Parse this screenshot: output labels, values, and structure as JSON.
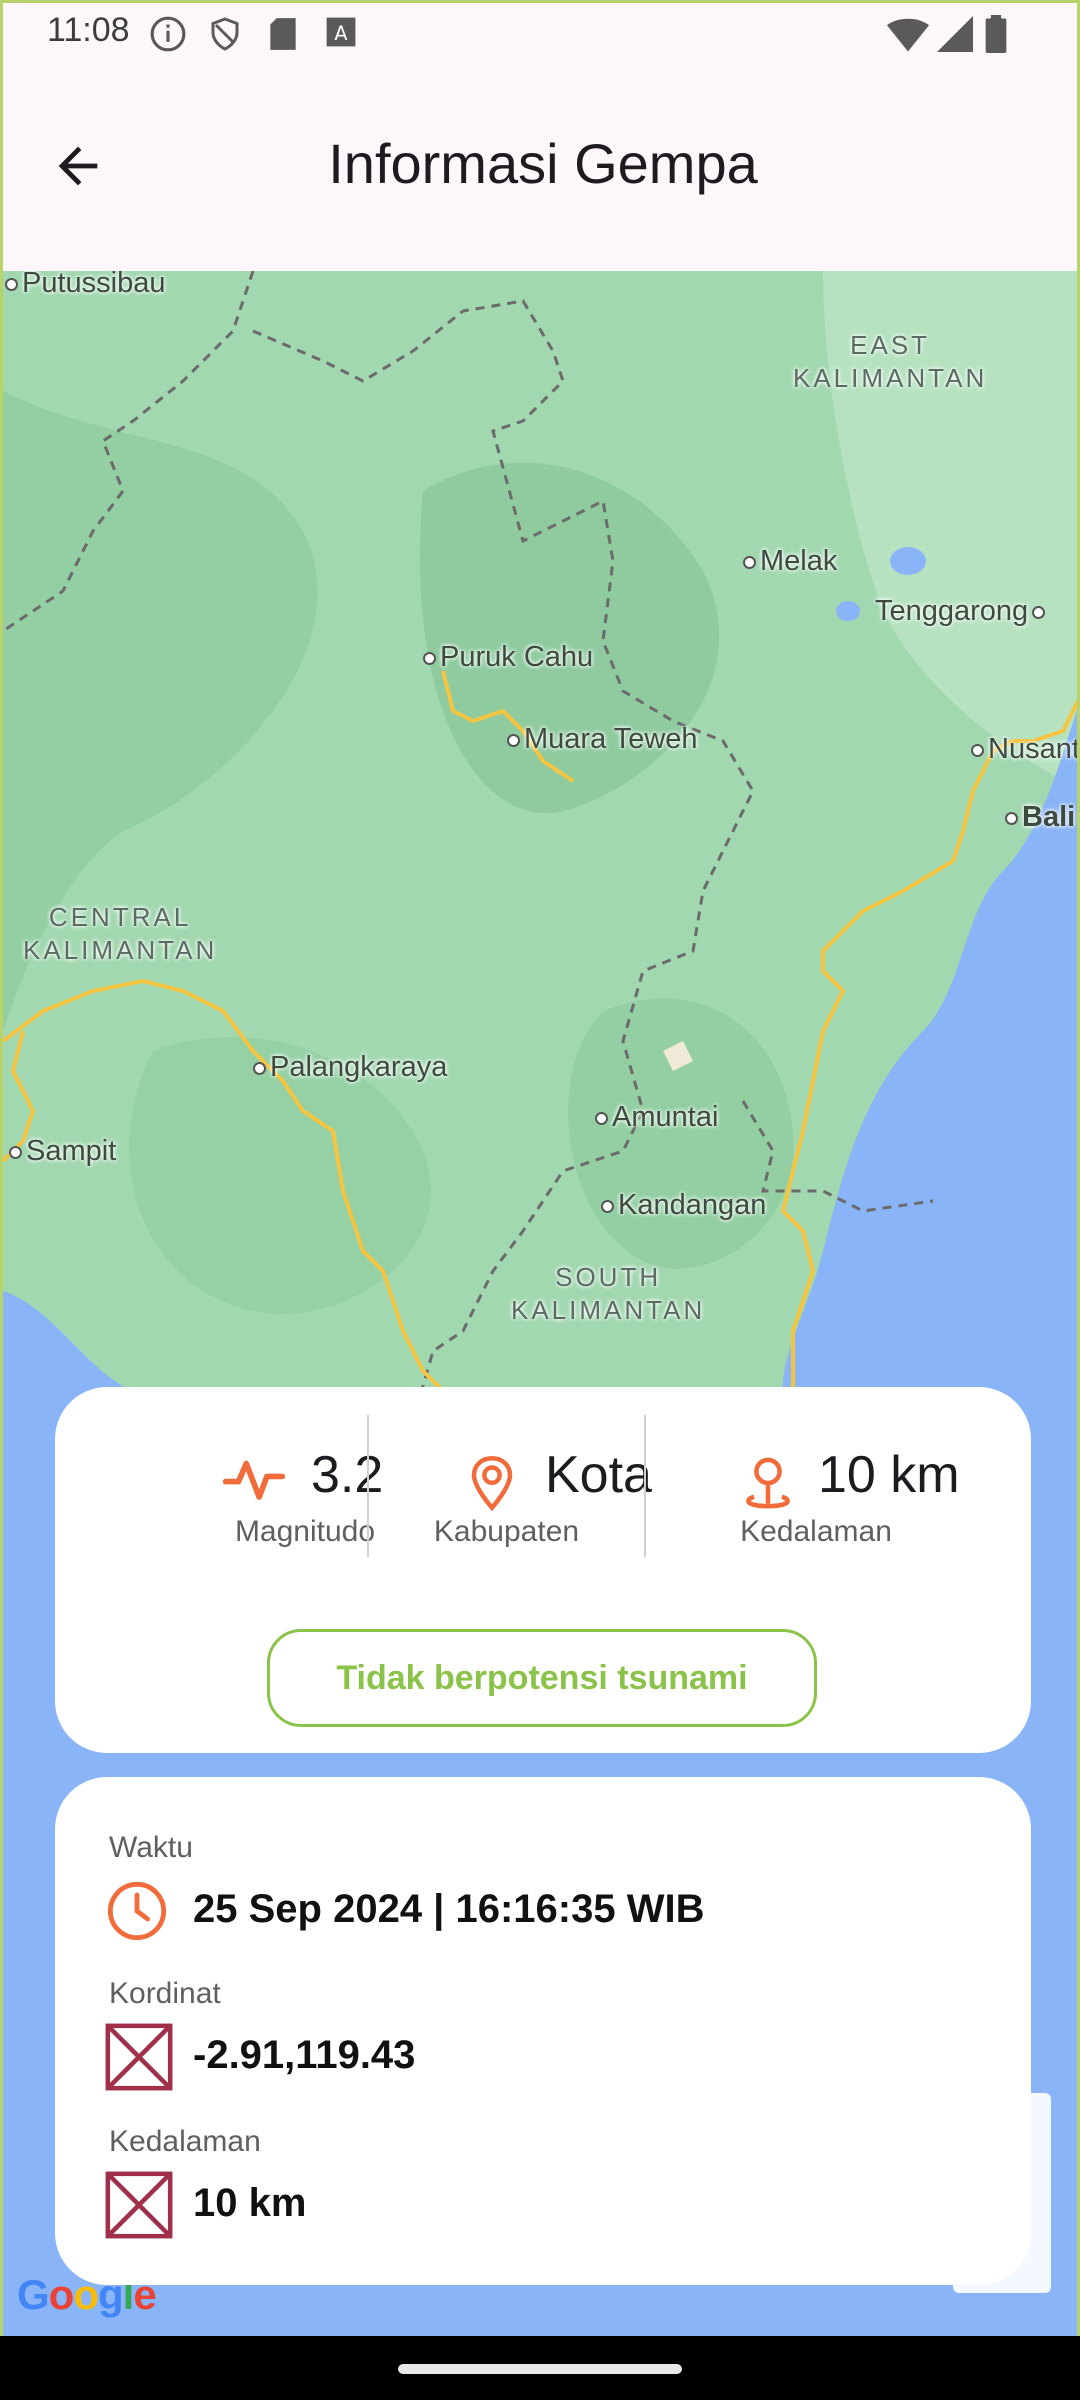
{
  "status_bar": {
    "time": "11:08",
    "left_icons": [
      "info-icon",
      "shield-icon",
      "sd-card-icon",
      "keyboard-icon"
    ],
    "right_icons": [
      "wifi-icon",
      "cell-signal-icon",
      "battery-icon"
    ]
  },
  "app_bar": {
    "title": "Informasi Gempa",
    "back_icon": "arrow-back-icon"
  },
  "map": {
    "places": [
      "Putussibau",
      "Melak",
      "Tenggarong",
      "Puruk Cahu",
      "Muara Teweh",
      "Nusant",
      "Bali",
      "Palangkaraya",
      "Sampit",
      "Amuntai",
      "Kandangan"
    ],
    "regions": {
      "east": "EAST\nKALIMANTAN",
      "central": "CENTRAL\nKALIMANTAN",
      "south": "SOUTH\nKALIMANTAN"
    },
    "attribution": "Google"
  },
  "summary": {
    "magnitude": {
      "value": "3.2",
      "label": "Magnitudo",
      "icon": "activity-icon"
    },
    "location": {
      "value": "Kota",
      "label": "Kabupaten",
      "icon": "location-pin-icon"
    },
    "depth": {
      "value": "10 km",
      "label": "Kedalaman",
      "icon": "depth-pin-icon"
    },
    "tsunami_label": "Tidak berpotensi tsunami"
  },
  "details": {
    "time": {
      "label": "Waktu",
      "value": "25 Sep 2024 | 16:16:35 WIB",
      "icon": "clock-icon"
    },
    "coordinates": {
      "label": "Kordinat",
      "value": "-2.91,119.43",
      "icon": "broken-image-icon"
    },
    "depth": {
      "label": "Kedalaman",
      "value": "10 km",
      "icon": "broken-image-icon"
    }
  },
  "colors": {
    "accent_orange": "#f26b3a",
    "tsunami_green": "#8bc34a",
    "broken_icon": "#a0304a",
    "map_land": "#a2d8b0",
    "map_water": "#8ab4f8"
  }
}
